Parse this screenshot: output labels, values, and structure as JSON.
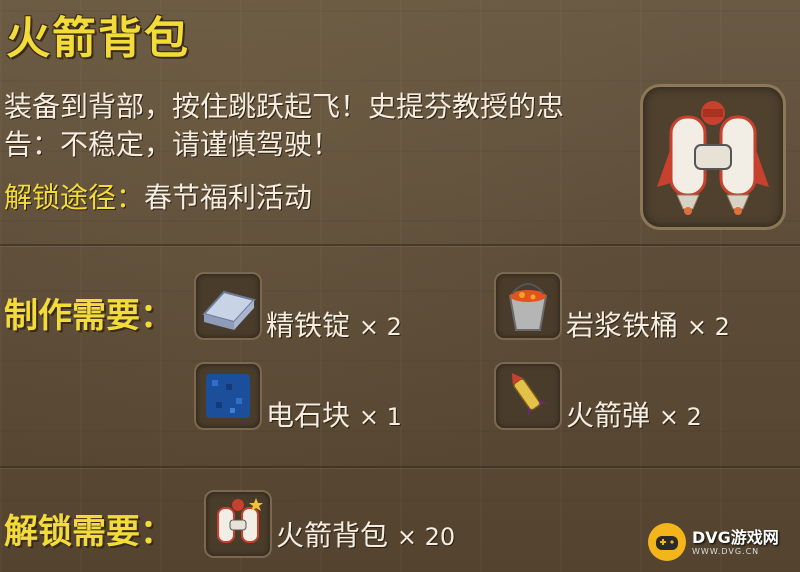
{
  "item": {
    "title": "火箭背包",
    "description": "装备到背部，按住跳跃起飞！史提芬教授的忠告：不稳定，请谨慎驾驶！",
    "unlock_path_label": "解锁途径：",
    "unlock_path_value": "春节福利活动",
    "icon": "rocket-backpack-icon"
  },
  "crafting": {
    "label": "制作需要：",
    "materials": [
      {
        "name": "精铁锭",
        "qty": "× 2",
        "icon": "iron-ingot-icon"
      },
      {
        "name": "岩浆铁桶",
        "qty": "× 2",
        "icon": "lava-bucket-icon"
      },
      {
        "name": "电石块",
        "qty": "× 1",
        "icon": "carbide-block-icon"
      },
      {
        "name": "火箭弹",
        "qty": "× 2",
        "icon": "rocket-shell-icon"
      }
    ]
  },
  "unlock": {
    "label": "解锁需要：",
    "item_name": "火箭背包",
    "qty": "× 20",
    "icon": "rocket-backpack-icon"
  },
  "watermark": {
    "text": "DVG游戏网",
    "sub": "WWW.DVG.CN"
  },
  "colors": {
    "accent_yellow": "#f3dc3a",
    "text_light": "#f4ede0",
    "panel_brown": "#5c4c38"
  }
}
